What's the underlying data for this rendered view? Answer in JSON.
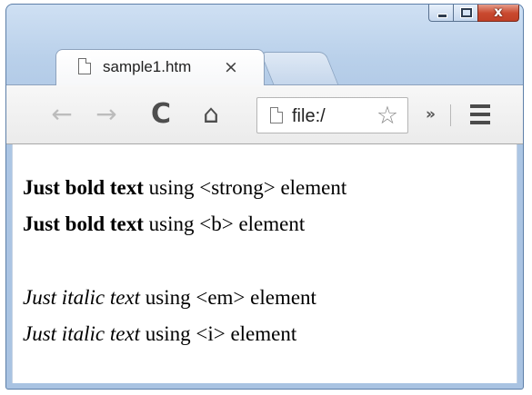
{
  "window": {
    "caption": {
      "minimize_icon": "minimize-icon",
      "maximize_icon": "maximize-icon",
      "close_icon": "close-icon",
      "close_glyph": "x",
      "close_color": "#c9492f"
    }
  },
  "tabs": [
    {
      "title": "sample1.htm",
      "favicon": "page-icon",
      "close_glyph": "×"
    }
  ],
  "new_tab": {
    "icon": "new-tab-icon"
  },
  "toolbar": {
    "back_glyph": "←",
    "forward_glyph": "→",
    "reload_glyph": "C",
    "home_glyph": "⌂",
    "address": {
      "url": "file:/",
      "page_icon": "page-icon",
      "bookmark_glyph": "☆"
    },
    "overflow_glyph": "»",
    "menu_icon": "hamburger-menu-icon"
  },
  "page": {
    "lines": [
      {
        "emphasis": "Just bold text",
        "rest": " using <strong> element",
        "style": "bold"
      },
      {
        "emphasis": "Just bold text",
        "rest": " using <b> element",
        "style": "bold"
      },
      {
        "emphasis": "Just italic text",
        "rest": " using <em> element",
        "style": "italic"
      },
      {
        "emphasis": "Just italic text",
        "rest": " using <i> element",
        "style": "italic"
      }
    ]
  },
  "colors": {
    "frame": "#b9d0ea",
    "toolbar": "#f2f2f2",
    "disabled_nav": "#bcbcbc"
  }
}
